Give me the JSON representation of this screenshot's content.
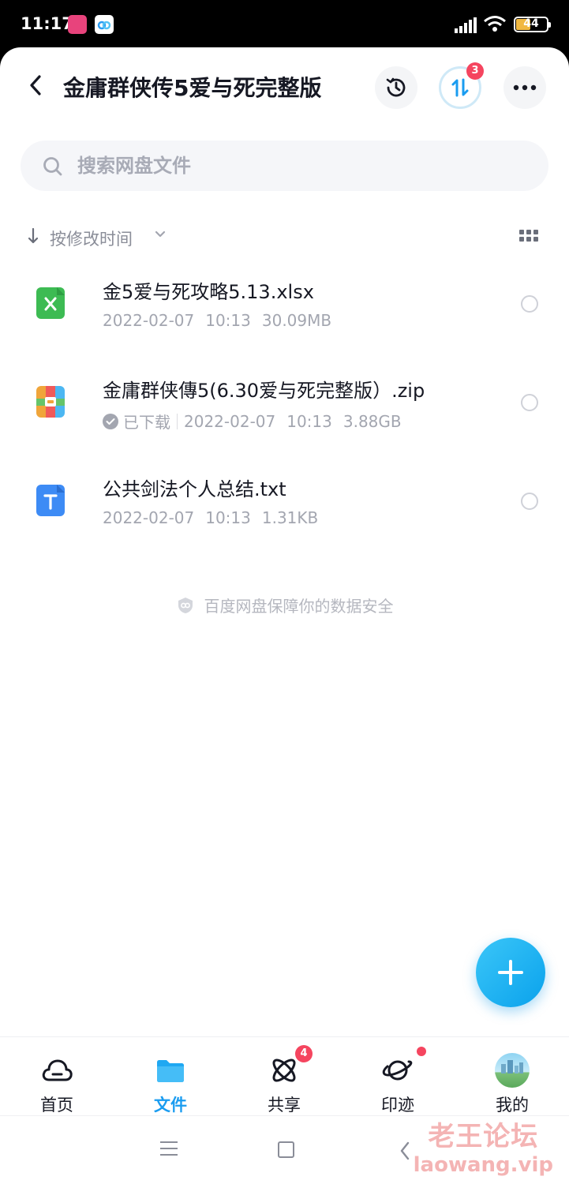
{
  "status_bar": {
    "time": "11:17",
    "battery": "44"
  },
  "header": {
    "title": "金庸群侠传5爱与死完整版",
    "transfer_badge": "3"
  },
  "search": {
    "placeholder": "搜索网盘文件"
  },
  "sort": {
    "label": "按修改时间"
  },
  "files": [
    {
      "name": "金5爱与死攻略5.13.xlsx",
      "downloaded": "",
      "date": "2022-02-07",
      "time": "10:13",
      "size": "30.09MB",
      "icon": "xlsx-file-icon",
      "color": "#3dbb53"
    },
    {
      "name": "金庸群侠傳5(6.30爱与死完整版）.zip",
      "downloaded": "已下载",
      "date": "2022-02-07",
      "time": "10:13",
      "size": "3.88GB",
      "icon": "zip-file-icon",
      "color": "#f0a53a"
    },
    {
      "name": "公共剑法个人总结.txt",
      "downloaded": "",
      "date": "2022-02-07",
      "time": "10:13",
      "size": "1.31KB",
      "icon": "txt-file-icon",
      "color": "#3d8bf5"
    }
  ],
  "safety_text": "百度网盘保障你的数据安全",
  "tabs": [
    {
      "label": "首页",
      "icon": "cloud-icon"
    },
    {
      "label": "文件",
      "icon": "folder-icon",
      "active": true
    },
    {
      "label": "共享",
      "icon": "atom-icon",
      "badge": "4"
    },
    {
      "label": "印迹",
      "icon": "planet-icon",
      "dot": true
    },
    {
      "label": "我的",
      "icon": "avatar"
    }
  ],
  "watermark": {
    "line1": "老王论坛",
    "line2": "laowang.vip"
  },
  "colors": {
    "accent": "#1a9cf0",
    "badge": "#f5455f"
  }
}
